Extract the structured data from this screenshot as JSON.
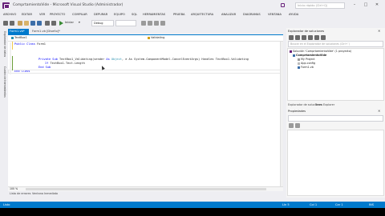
{
  "window": {
    "title": "ComprtamientoVide - Microsoft Visual Studio (Administrador)",
    "quick_launch_placeholder": "Inicio rápido (Ctrl+Q)",
    "search_hint": "Herramientas"
  },
  "menu": [
    "ARCHIVO",
    "EDITAR",
    "VER",
    "PROYECTO",
    "COMPILAR",
    "DEPURAR",
    "EQUIPO",
    "SQL",
    "HERRAMIENTAS",
    "PRUEBA",
    "ARQUITECTURA",
    "ANALIZAR",
    "DIAGRAMAS",
    "VENTANA",
    "AYUDA"
  ],
  "toolbar": {
    "start_label": "Iniciar",
    "config_value": "Debug",
    "platform_value": ""
  },
  "left_strip": {
    "tab1": "Explorador de datos",
    "tab2": "Cuadro de herramientas"
  },
  "doc_tabs": {
    "active": "Form1.vb*",
    "second": "Form1.vb [Diseño]*"
  },
  "navbar": {
    "left": "TextBox1",
    "right": "Validating"
  },
  "code": {
    "line1_kw": "Public Class",
    "line1_name": "Form1",
    "line2_pre": "Private Sub",
    "line2_name": "TextBox1_Validating(sender",
    "line2_kw2": "As",
    "line2_ty": "Object",
    "line2_rest": ", e As System.ComponentModel.CancelEventArgs) Handles TextBox1.Validating",
    "line3_kw": "If",
    "line3_rest": "TextBox1.Text.Length",
    "line4": "End Sub",
    "line5": "End Class"
  },
  "zoom": "100 %",
  "bottom_tabs": {
    "tab1": "Lista de errores",
    "tab2": "Ventana Inmediato"
  },
  "solution_explorer": {
    "title": "Explorador de soluciones",
    "search_placeholder": "Buscar en el Explorador de soluciones (Ctrl+`)",
    "solution": "Solución 'ComprtamientoVide' (1 proyecto)",
    "project": "ComprtamientoVide",
    "item1": "My Project",
    "item2": "App.config",
    "item3": "Form1.vb"
  },
  "lower_tabs": {
    "tab1": "Explorador de soluciones",
    "tab2": "Team Explorer"
  },
  "properties": {
    "title": "Propiedades"
  },
  "status": {
    "left": "Listo",
    "line": "Lín 5",
    "col": "Col 1",
    "car": "Car 1",
    "ins": "INS"
  },
  "colors": {
    "accent": "#007acc",
    "vs_purple": "#68217a"
  }
}
